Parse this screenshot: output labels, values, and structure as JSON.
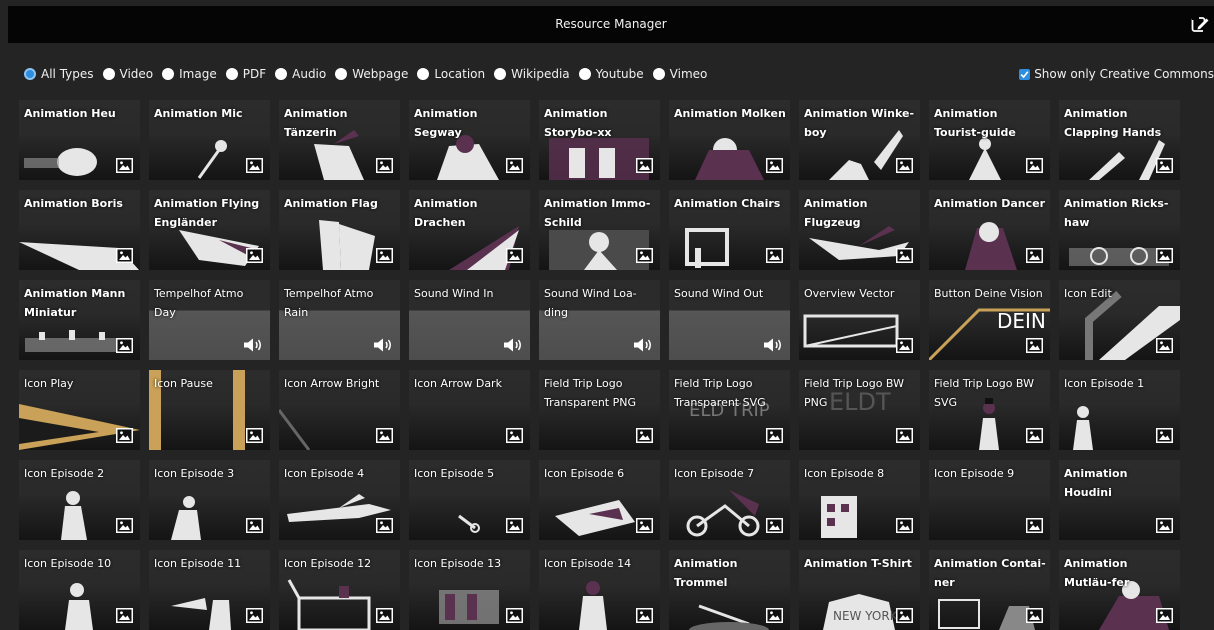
{
  "window": {
    "title": "Resource Manager",
    "edit_icon": "edit-icon"
  },
  "filters": {
    "types": [
      {
        "label": "All Types",
        "selected": true
      },
      {
        "label": "Video",
        "selected": false
      },
      {
        "label": "Image",
        "selected": false
      },
      {
        "label": "PDF",
        "selected": false
      },
      {
        "label": "Audio",
        "selected": false
      },
      {
        "label": "Webpage",
        "selected": false
      },
      {
        "label": "Location",
        "selected": false
      },
      {
        "label": "Wikipedia",
        "selected": false
      },
      {
        "label": "Youtube",
        "selected": false
      },
      {
        "label": "Vimeo",
        "selected": false
      }
    ],
    "creative_commons": {
      "label": "Show only Creative Commons",
      "checked": true
    }
  },
  "colors": {
    "accent": "#2f8ddf",
    "brand_purple": "#5b3150",
    "brand_gold": "#c9a158"
  },
  "resources": [
    {
      "title": "Animation Heu",
      "kind": "image"
    },
    {
      "title": "Animation Mic",
      "kind": "image"
    },
    {
      "title": "Animation Tänzerin",
      "kind": "image"
    },
    {
      "title": "Animation Segway",
      "kind": "image"
    },
    {
      "title": "Animation Storybo-xx",
      "kind": "image"
    },
    {
      "title": "Animation Molken",
      "kind": "image"
    },
    {
      "title": "Animation Winke-boy",
      "kind": "image"
    },
    {
      "title": "Animation Tourist-guide",
      "kind": "image"
    },
    {
      "title": "Animation Clapping Hands",
      "kind": "image"
    },
    {
      "title": "Animation Boris",
      "kind": "image"
    },
    {
      "title": "Animation Flying Engländer",
      "kind": "image"
    },
    {
      "title": "Animation Flag",
      "kind": "image"
    },
    {
      "title": "Animation Drachen",
      "kind": "image"
    },
    {
      "title": "Animation Immo-Schild",
      "kind": "image"
    },
    {
      "title": "Animation Chairs",
      "kind": "image"
    },
    {
      "title": "Animation Flugzeug",
      "kind": "image"
    },
    {
      "title": "Animation Dancer",
      "kind": "image"
    },
    {
      "title": "Animation Ricks-haw",
      "kind": "image"
    },
    {
      "title": "Animation Mann Miniatur",
      "kind": "image"
    },
    {
      "title": "Tempelhof Atmo Day",
      "kind": "audio"
    },
    {
      "title": "Tempelhof Atmo Rain",
      "kind": "audio"
    },
    {
      "title": "Sound Wind In",
      "kind": "audio"
    },
    {
      "title": "Sound Wind Loa-ding",
      "kind": "audio"
    },
    {
      "title": "Sound Wind Out",
      "kind": "audio"
    },
    {
      "title": "Overview Vector",
      "kind": "image"
    },
    {
      "title": "Button Deine Vision",
      "kind": "image"
    },
    {
      "title": "Icon Edit",
      "kind": "image"
    },
    {
      "title": "Icon Play",
      "kind": "image"
    },
    {
      "title": "Icon Pause",
      "kind": "image"
    },
    {
      "title": "Icon Arrow Bright",
      "kind": "image"
    },
    {
      "title": "Icon Arrow Dark",
      "kind": "image"
    },
    {
      "title": "Field Trip Logo Transparent PNG",
      "kind": "image"
    },
    {
      "title": "Field Trip Logo Transparent SVG",
      "kind": "image"
    },
    {
      "title": "Field Trip Logo BW PNG",
      "kind": "image"
    },
    {
      "title": "Field Trip Logo BW SVG",
      "kind": "image"
    },
    {
      "title": "Icon Episode 1",
      "kind": "image"
    },
    {
      "title": "Icon Episode 2",
      "kind": "image"
    },
    {
      "title": "Icon Episode 3",
      "kind": "image"
    },
    {
      "title": "Icon Episode 4",
      "kind": "image"
    },
    {
      "title": "Icon Episode 5",
      "kind": "image"
    },
    {
      "title": "Icon Episode 6",
      "kind": "image"
    },
    {
      "title": "Icon Episode 7",
      "kind": "image"
    },
    {
      "title": "Icon Episode 8",
      "kind": "image"
    },
    {
      "title": "Icon Episode 9",
      "kind": "image"
    },
    {
      "title": "Animation Houdini",
      "kind": "image"
    },
    {
      "title": "Icon Episode 10",
      "kind": "image"
    },
    {
      "title": "Icon Episode 11",
      "kind": "image"
    },
    {
      "title": "Icon Episode 12",
      "kind": "image"
    },
    {
      "title": "Icon Episode 13",
      "kind": "image"
    },
    {
      "title": "Icon Episode 14",
      "kind": "image"
    },
    {
      "title": "Animation Trommel",
      "kind": "image"
    },
    {
      "title": "Animation T-Shirt",
      "kind": "image"
    },
    {
      "title": "Animation Contai-ner",
      "kind": "image"
    },
    {
      "title": "Animation Mutläu-fer",
      "kind": "image"
    }
  ]
}
